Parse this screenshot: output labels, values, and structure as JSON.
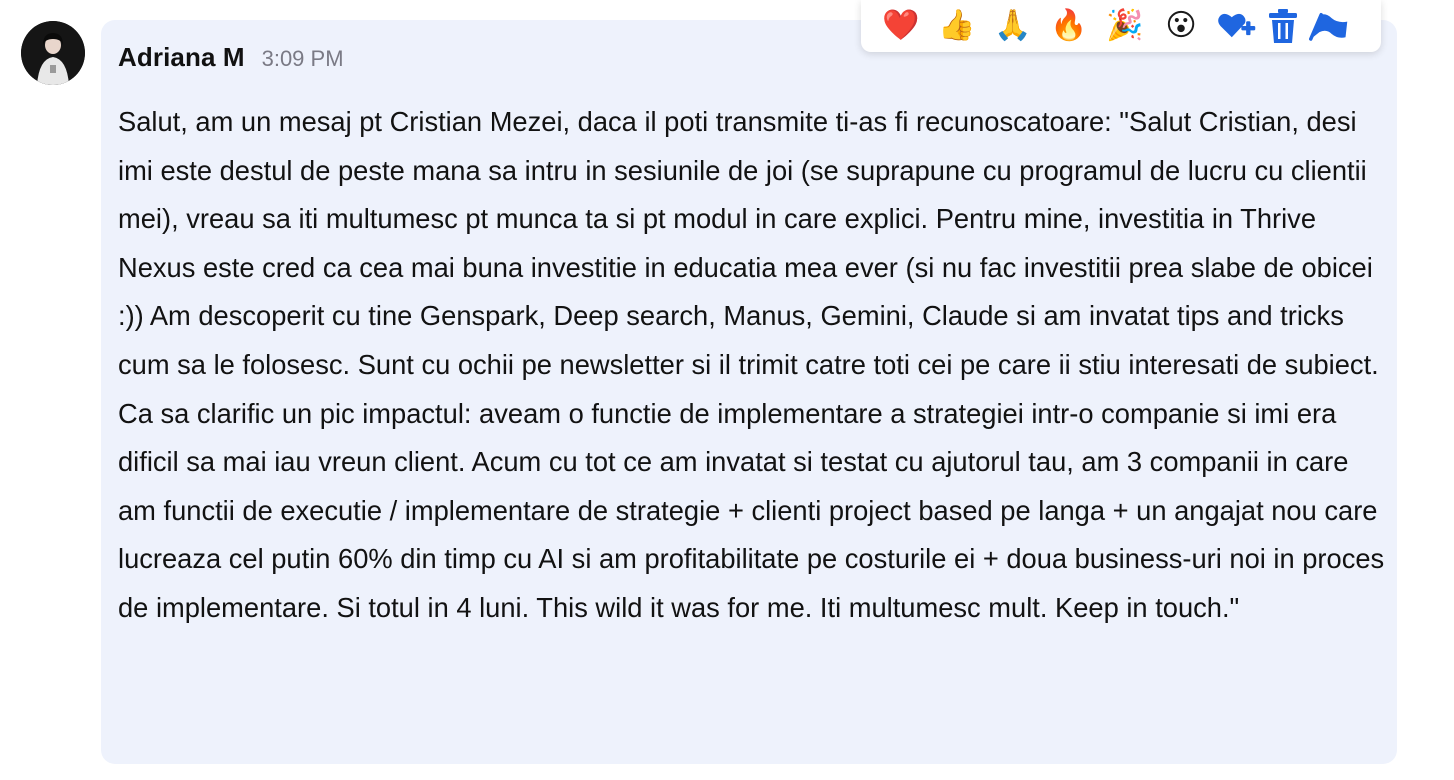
{
  "message": {
    "author": "Adriana M",
    "time": "3:09 PM",
    "text": "Salut, am un mesaj pt Cristian Mezei, daca il poti transmite ti-as fi recunoscatoare: \"Salut Cristian, desi imi este destul de peste mana sa intru in sesiunile de joi (se suprapune cu programul de lucru cu clientii mei), vreau sa iti multumesc pt munca ta si pt modul in care explici. Pentru mine, investitia in Thrive Nexus este cred ca cea mai buna investitie in educatia mea ever (si nu fac investitii prea slabe de obicei :)) Am descoperit cu tine Genspark, Deep search, Manus, Gemini, Claude si am invatat tips and tricks cum sa le folosesc. Sunt cu ochii pe newsletter si il trimit catre toti cei pe care ii stiu interesati de subiect. Ca sa clarific un pic impactul: aveam o functie de implementare a strategiei intr-o companie si imi era dificil sa mai iau vreun client. Acum cu tot ce am invatat si testat cu ajutorul tau, am 3 companii in care am functii de executie / implementare de strategie + clienti project based pe langa + un angajat nou care lucreaza cel putin 60% din timp cu AI si am profitabilitate pe costurile ei + doua business-uri noi in proces de implementare. Si totul in 4 luni. This wild it was for me. Iti multumesc mult. Keep in touch.\""
  },
  "reactions": [
    {
      "icon": "red-heart-icon",
      "glyph": "❤️"
    },
    {
      "icon": "thumbs-up-icon",
      "glyph": "👍"
    },
    {
      "icon": "folded-hands-icon",
      "glyph": "🙏"
    },
    {
      "icon": "fire-icon",
      "glyph": "🔥"
    },
    {
      "icon": "party-popper-icon",
      "glyph": "🎉"
    },
    {
      "icon": "surprised-face-icon",
      "glyph": "😮"
    }
  ],
  "actions": [
    {
      "icon": "add-reaction-heart-icon"
    },
    {
      "icon": "trash-icon"
    },
    {
      "icon": "flag-icon"
    }
  ],
  "colors": {
    "bubble_bg": "#eef2fc",
    "action_blue": "#1f66e0",
    "timestamp": "#7a7a85"
  }
}
